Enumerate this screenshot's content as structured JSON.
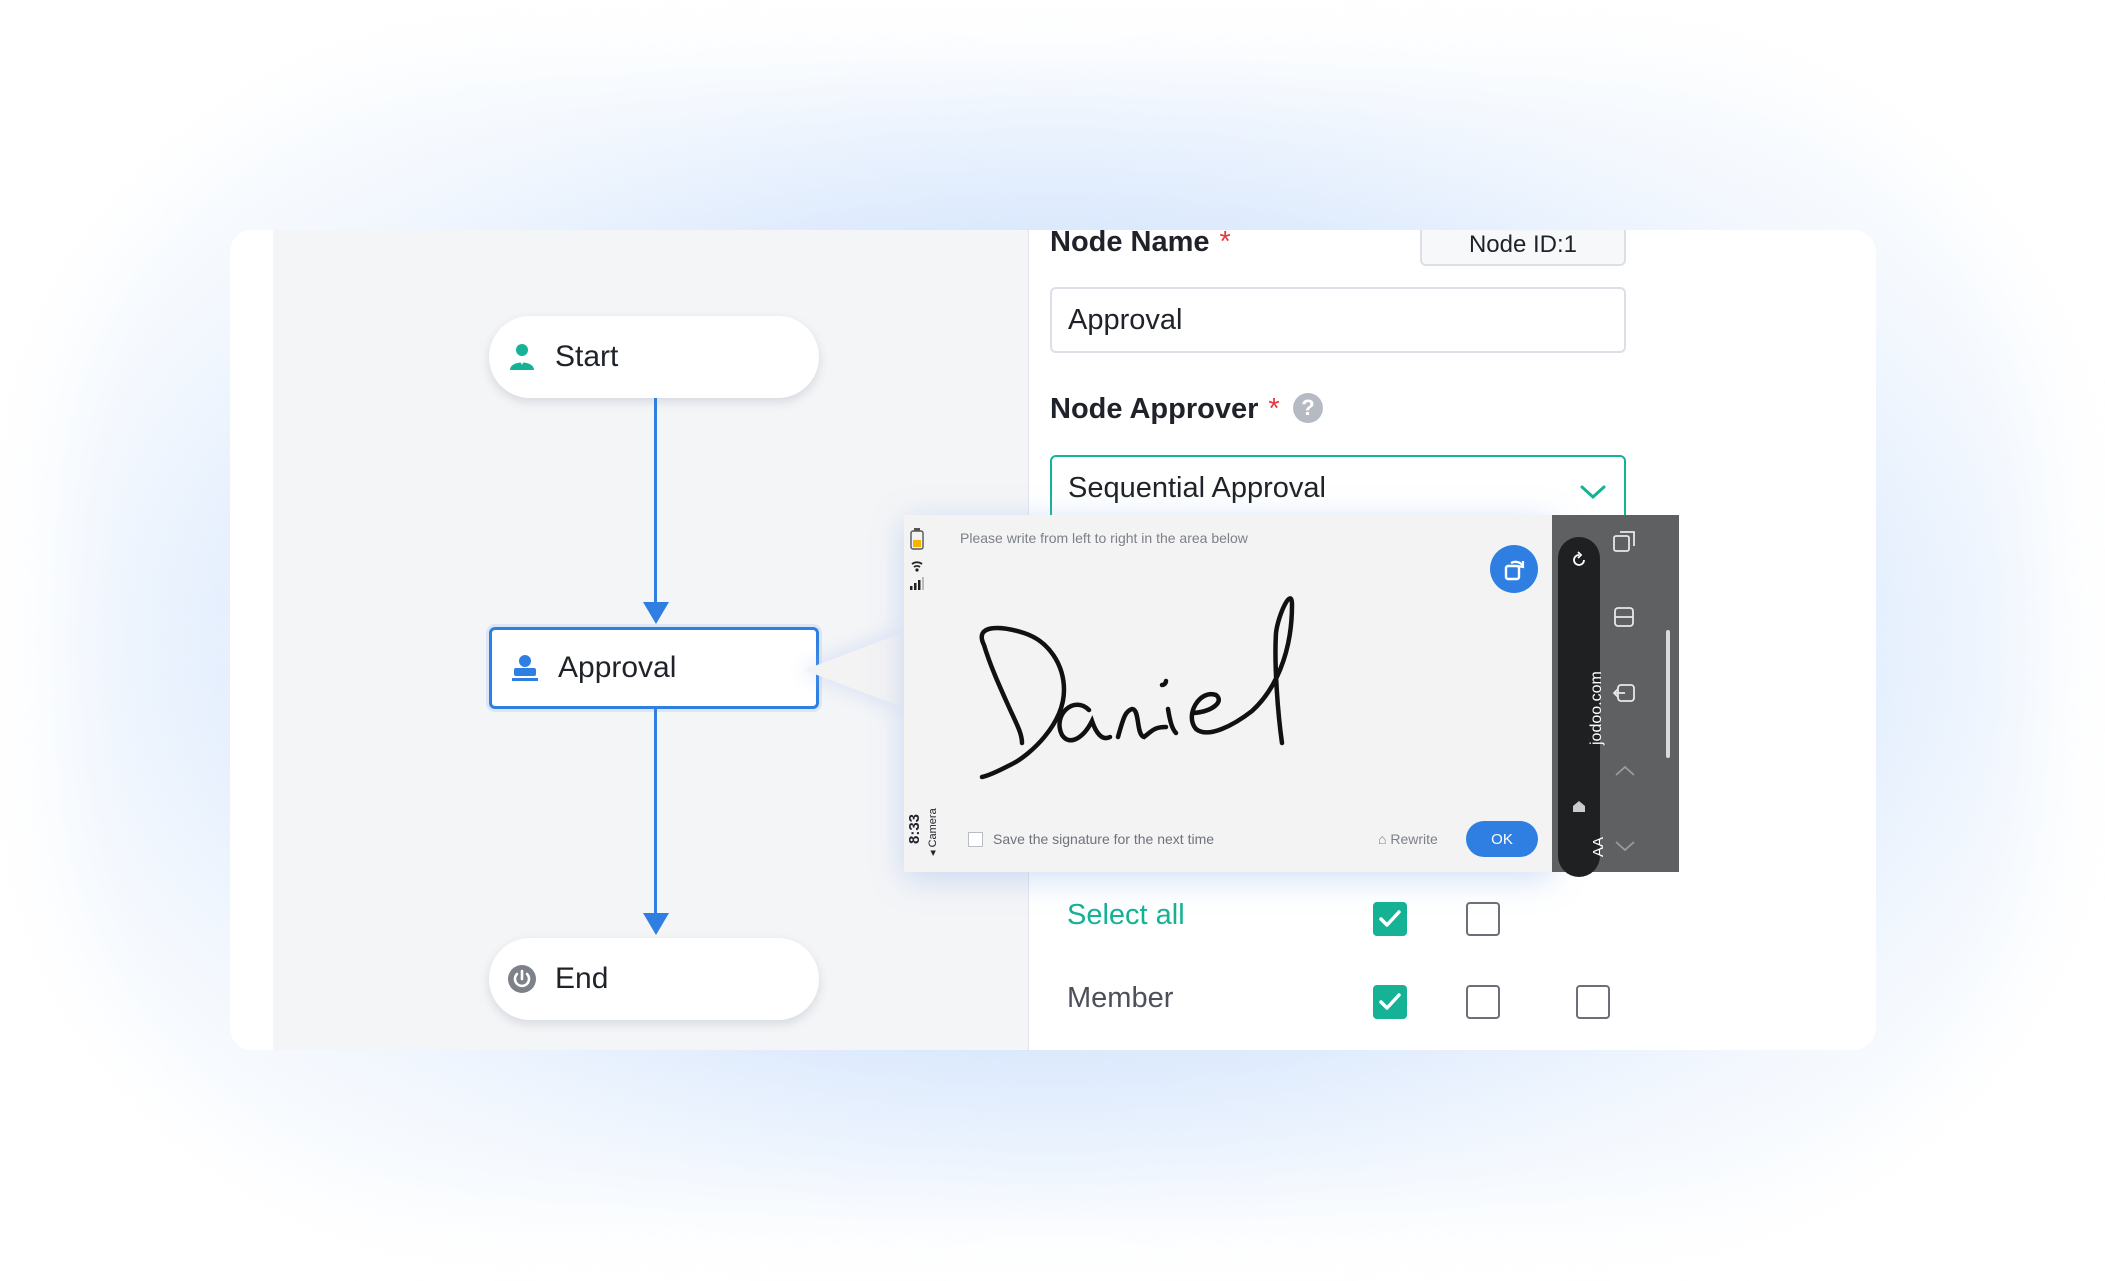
{
  "flow": {
    "start_label": "Start",
    "approval_label": "Approval",
    "end_label": "End"
  },
  "form": {
    "node_name_label": "Node Name",
    "required_mark": "*",
    "node_id": "Node ID:1",
    "node_name_value": "Approval",
    "node_approver_label": "Node Approver",
    "help_glyph": "?",
    "approver_select_value": "Sequential Approval",
    "permissions": {
      "select_all_label": "Select all",
      "member_label": "Member",
      "select_all_checked": [
        true,
        false
      ],
      "member_checked": [
        true,
        false,
        false
      ]
    }
  },
  "signature_pad": {
    "hint": "Please write from left to right in the area below",
    "signature_text": "Daniel",
    "save_checkbox_label": "Save the signature for the next time",
    "rewrite_label": "Rewrite",
    "ok_label": "OK",
    "status_time": "8:33",
    "status_app": "◂ Camera"
  },
  "browser_bar": {
    "url": "jodoo.com",
    "text_size_label": "AA"
  },
  "colors": {
    "primary_blue": "#2f7fe2",
    "accent_green": "#15b295",
    "required_red": "#e5383b"
  }
}
